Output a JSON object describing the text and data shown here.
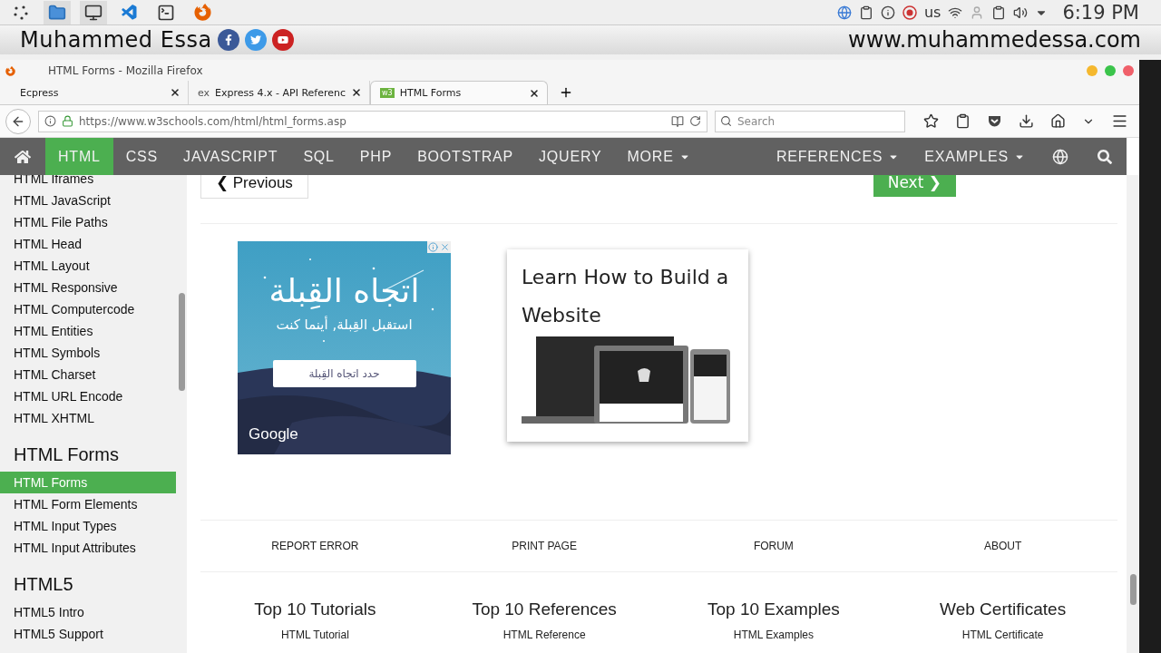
{
  "desktop_bar": {
    "keyboard_layout": "us",
    "clock": "6:19 PM"
  },
  "banner": {
    "name": "Muhammed Essa",
    "website": "www.muhammedessa.com"
  },
  "window": {
    "title": "HTML Forms - Mozilla Firefox"
  },
  "tabs": [
    {
      "label": "Ecpress",
      "selected": false,
      "kind": "plain"
    },
    {
      "label": "Express 4.x - API Referenc",
      "selected": false,
      "kind": "text",
      "favicon_text": "ex"
    },
    {
      "label": "HTML Forms",
      "selected": true,
      "kind": "badge",
      "favicon_text": "w3"
    }
  ],
  "address_bar": {
    "url": "https://www.w3schools.com/html/html_forms.asp",
    "secure": true
  },
  "search": {
    "placeholder": "Search"
  },
  "site_nav": {
    "items": [
      {
        "label": "HTML",
        "selected": true,
        "dropdown": false
      },
      {
        "label": "CSS",
        "selected": false,
        "dropdown": false
      },
      {
        "label": "JAVASCRIPT",
        "selected": false,
        "dropdown": false
      },
      {
        "label": "SQL",
        "selected": false,
        "dropdown": false
      },
      {
        "label": "PHP",
        "selected": false,
        "dropdown": false
      },
      {
        "label": "BOOTSTRAP",
        "selected": false,
        "dropdown": false
      },
      {
        "label": "JQUERY",
        "selected": false,
        "dropdown": false
      },
      {
        "label": "MORE",
        "selected": false,
        "dropdown": true
      }
    ],
    "right_items": [
      {
        "label": "REFERENCES",
        "dropdown": true
      },
      {
        "label": "EXAMPLES",
        "dropdown": true
      }
    ]
  },
  "sidebar": {
    "sections": [
      {
        "items": [
          {
            "label": "HTML Iframes",
            "selected": false
          },
          {
            "label": "HTML JavaScript",
            "selected": false
          },
          {
            "label": "HTML File Paths",
            "selected": false
          },
          {
            "label": "HTML Head",
            "selected": false
          },
          {
            "label": "HTML Layout",
            "selected": false
          },
          {
            "label": "HTML Responsive",
            "selected": false
          },
          {
            "label": "HTML Computercode",
            "selected": false
          },
          {
            "label": "HTML Entities",
            "selected": false
          },
          {
            "label": "HTML Symbols",
            "selected": false
          },
          {
            "label": "HTML Charset",
            "selected": false
          },
          {
            "label": "HTML URL Encode",
            "selected": false
          },
          {
            "label": "HTML XHTML",
            "selected": false
          }
        ]
      },
      {
        "heading": "HTML Forms",
        "items": [
          {
            "label": "HTML Forms",
            "selected": true
          },
          {
            "label": "HTML Form Elements",
            "selected": false
          },
          {
            "label": "HTML Input Types",
            "selected": false
          },
          {
            "label": "HTML Input Attributes",
            "selected": false
          }
        ]
      },
      {
        "heading": "HTML5",
        "items": [
          {
            "label": "HTML5 Intro",
            "selected": false
          },
          {
            "label": "HTML5 Support",
            "selected": false
          }
        ]
      }
    ]
  },
  "pager": {
    "previous": "❮ Previous",
    "next": "Next ❯"
  },
  "ad": {
    "title": "اتجاه القِبلة",
    "subtitle": "استقبل القِبلة, أينما كنت",
    "button": "حدد اتجاه القِبلة",
    "brand": "Google"
  },
  "promo": {
    "title": "Learn How to Build a Website"
  },
  "footer_links": [
    "REPORT ERROR",
    "PRINT PAGE",
    "FORUM",
    "ABOUT"
  ],
  "footer_columns": [
    {
      "heading": "Top 10 Tutorials",
      "links": [
        "HTML Tutorial"
      ]
    },
    {
      "heading": "Top 10 References",
      "links": [
        "HTML Reference"
      ]
    },
    {
      "heading": "Top 10 Examples",
      "links": [
        "HTML Examples"
      ]
    },
    {
      "heading": "Web Certificates",
      "links": [
        "HTML Certificate"
      ]
    }
  ]
}
